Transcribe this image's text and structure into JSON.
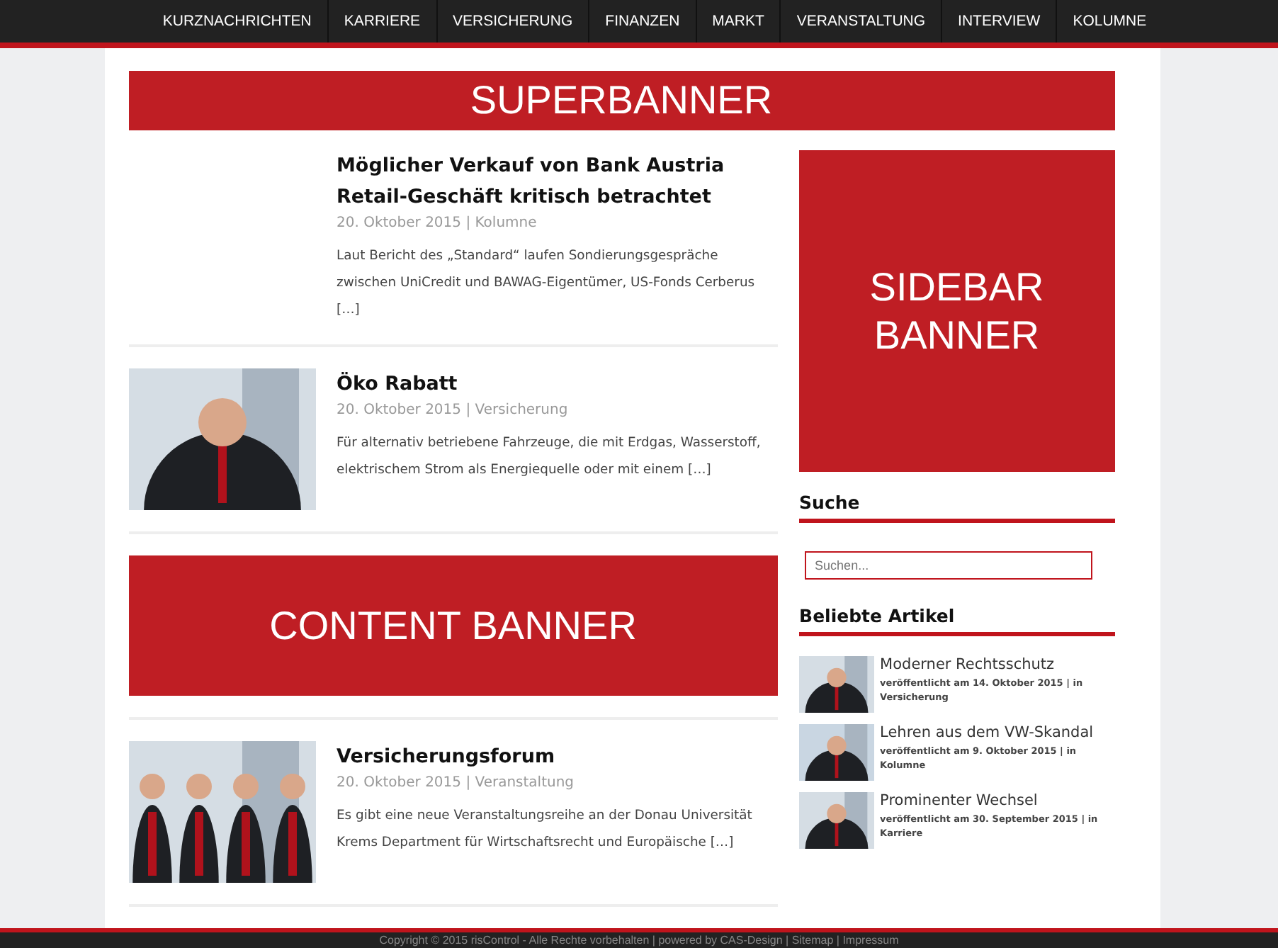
{
  "nav": [
    {
      "label": "KURZNACHRICHTEN"
    },
    {
      "label": "KARRIERE"
    },
    {
      "label": "VERSICHERUNG"
    },
    {
      "label": "FINANZEN"
    },
    {
      "label": "MARKT"
    },
    {
      "label": "VERANSTALTUNG"
    },
    {
      "label": "INTERVIEW"
    },
    {
      "label": "KOLUMNE"
    }
  ],
  "superbanner": "SUPERBANNER",
  "articles": [
    {
      "kind": "article",
      "title": "Möglicher Verkauf von Bank Austria Retail-Geschäft kritisch betrachtet",
      "meta": "20. Oktober 2015 | Kolumne",
      "excerpt": "Laut Bericht des „Standard“ laufen Sondierungsgespräche zwischen UniCredit und BAWAG-Eigentümer, US-Fonds Cerberus […]"
    },
    {
      "kind": "article",
      "title": "Öko Rabatt",
      "meta": "20. Oktober 2015 | Versicherung",
      "excerpt": "Für alternativ betriebene Fahrzeuge, die mit Erdgas, Wasserstoff, elektrischem Strom als Energiequelle oder mit einem […]"
    },
    {
      "kind": "banner",
      "label": "CONTENT BANNER"
    },
    {
      "kind": "article",
      "title": "Versicherungsforum",
      "meta": "20. Oktober 2015 | Veranstaltung",
      "excerpt": "Es gibt eine neue Veranstaltungsreihe an der Donau Universität Krems Department für Wirtschaftsrecht und Europäische […]"
    }
  ],
  "sidebar": {
    "banner": "SIDEBAR BANNER",
    "search_title": "Suche",
    "search": {
      "placeholder": "Suchen..."
    },
    "popular_title": "Beliebte Artikel",
    "popular": [
      {
        "title": "Moderner Rechtsschutz",
        "meta": "veröffentlicht am 14. Oktober 2015 | in Versicherung"
      },
      {
        "title": "Lehren aus dem VW-Skandal",
        "meta": "veröffentlicht am 9. Oktober 2015 | in Kolumne"
      },
      {
        "title": "Prominenter Wechsel",
        "meta": "veröffentlicht am 30. September 2015 | in Karriere"
      }
    ]
  },
  "footer": "Copyright © 2015 risControl - Alle Rechte vorbehalten | powered by CAS-Design | Sitemap | Impressum"
}
